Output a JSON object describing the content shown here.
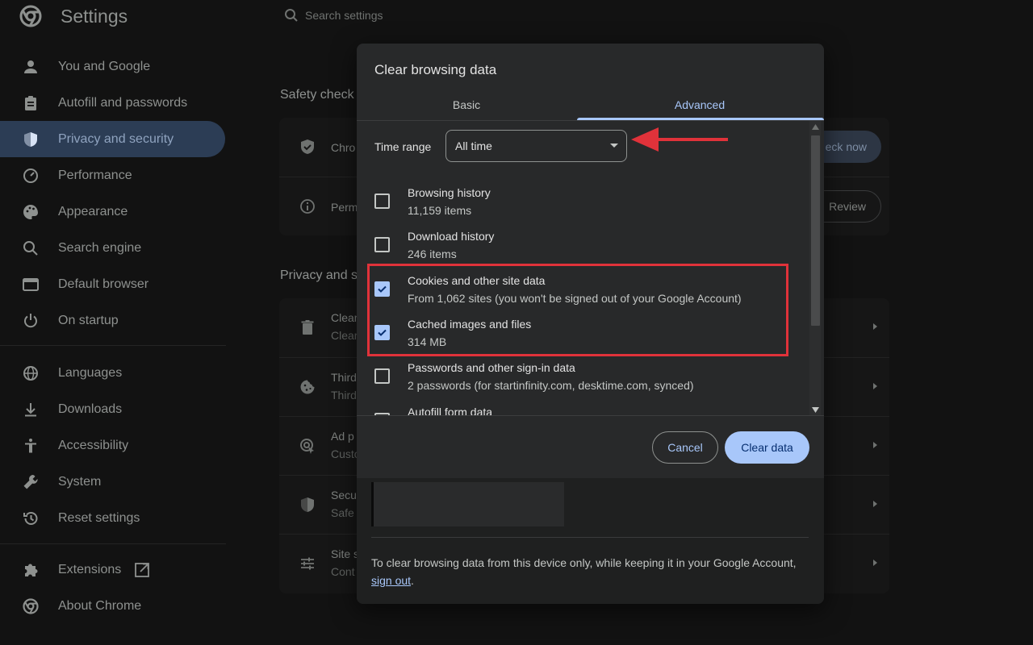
{
  "header": {
    "title": "Settings",
    "search_placeholder": "Search settings"
  },
  "sidebar": {
    "items": [
      {
        "label": "You and Google",
        "icon": "person-icon"
      },
      {
        "label": "Autofill and passwords",
        "icon": "clipboard-icon"
      },
      {
        "label": "Privacy and security",
        "icon": "shield-icon",
        "active": true
      },
      {
        "label": "Performance",
        "icon": "speedometer-icon"
      },
      {
        "label": "Appearance",
        "icon": "palette-icon"
      },
      {
        "label": "Search engine",
        "icon": "search-icon"
      },
      {
        "label": "Default browser",
        "icon": "browser-window-icon"
      },
      {
        "label": "On startup",
        "icon": "power-icon"
      },
      {
        "label": "Languages",
        "icon": "globe-icon"
      },
      {
        "label": "Downloads",
        "icon": "download-icon"
      },
      {
        "label": "Accessibility",
        "icon": "accessibility-icon"
      },
      {
        "label": "System",
        "icon": "wrench-icon"
      },
      {
        "label": "Reset settings",
        "icon": "history-icon"
      },
      {
        "label": "Extensions",
        "icon": "puzzle-icon"
      },
      {
        "label": "About Chrome",
        "icon": "chrome-icon"
      }
    ]
  },
  "main": {
    "safety_title": "Safety check",
    "safety_rows": [
      {
        "text": "Chro",
        "button": "eck now"
      },
      {
        "text": "Perm",
        "button": "Review"
      }
    ],
    "privacy_title": "Privacy and s",
    "privacy_rows": [
      {
        "line1": "Clear",
        "line2": "Clear"
      },
      {
        "line1": "Third",
        "line2": "Third"
      },
      {
        "line1": "Ad p",
        "line2": "Custo"
      },
      {
        "line1": "Secu",
        "line2": "Safe"
      },
      {
        "line1": "Site s",
        "line2": "Cont"
      }
    ]
  },
  "dialog": {
    "title": "Clear browsing data",
    "tabs": [
      {
        "label": "Basic",
        "active": false
      },
      {
        "label": "Advanced",
        "active": true
      }
    ],
    "time_range_label": "Time range",
    "time_range_value": "All time",
    "options": [
      {
        "title": "Browsing history",
        "detail": "11,159 items",
        "checked": false
      },
      {
        "title": "Download history",
        "detail": "246 items",
        "checked": false
      },
      {
        "title": "Cookies and other site data",
        "detail": "From 1,062 sites (you won't be signed out of your Google Account)",
        "checked": true
      },
      {
        "title": "Cached images and files",
        "detail": "314 MB",
        "checked": true
      },
      {
        "title": "Passwords and other sign-in data",
        "detail": "2 passwords (for startinfinity.com, desktime.com, synced)",
        "checked": false
      },
      {
        "title": "Autofill form data",
        "detail": "",
        "checked": false
      }
    ],
    "cancel_label": "Cancel",
    "clear_label": "Clear data",
    "footer_text": "To clear browsing data from this device only, while keeping it in your Google Account,",
    "footer_link": "sign out",
    "footer_end": "."
  },
  "colors": {
    "accent": "#a8c7fa",
    "annotation": "#e0323a",
    "dialog_bg": "#28292a",
    "page_bg": "#121212"
  }
}
